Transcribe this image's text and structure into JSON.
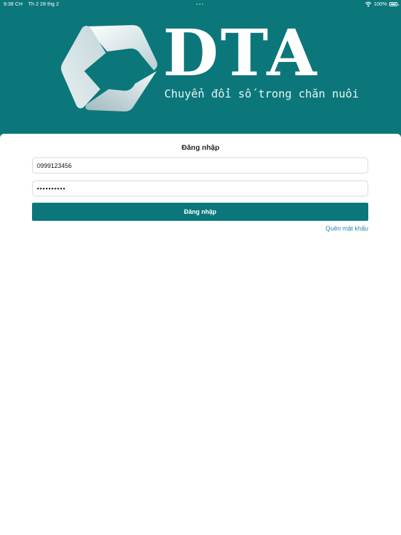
{
  "status_bar": {
    "time": "9:38 CH",
    "date": "Th 2 28 thg 2",
    "battery": "100%",
    "wifi_icon": "wifi-icon",
    "battery_icon": "battery-icon"
  },
  "branding": {
    "logo_text": "DTA",
    "tagline": "Chuyển đổi số trong chăn nuôi",
    "logo_icon": "hexagon-play-logo"
  },
  "login": {
    "title": "Đăng nhập",
    "phone_value": "0999123456",
    "password_value": "••••••••••",
    "submit_label": "Đăng nhập",
    "forgot_label": "Quên mật khẩu"
  },
  "colors": {
    "brand": "#0b777b",
    "link": "#2a89b0",
    "background": "#ffffff"
  }
}
